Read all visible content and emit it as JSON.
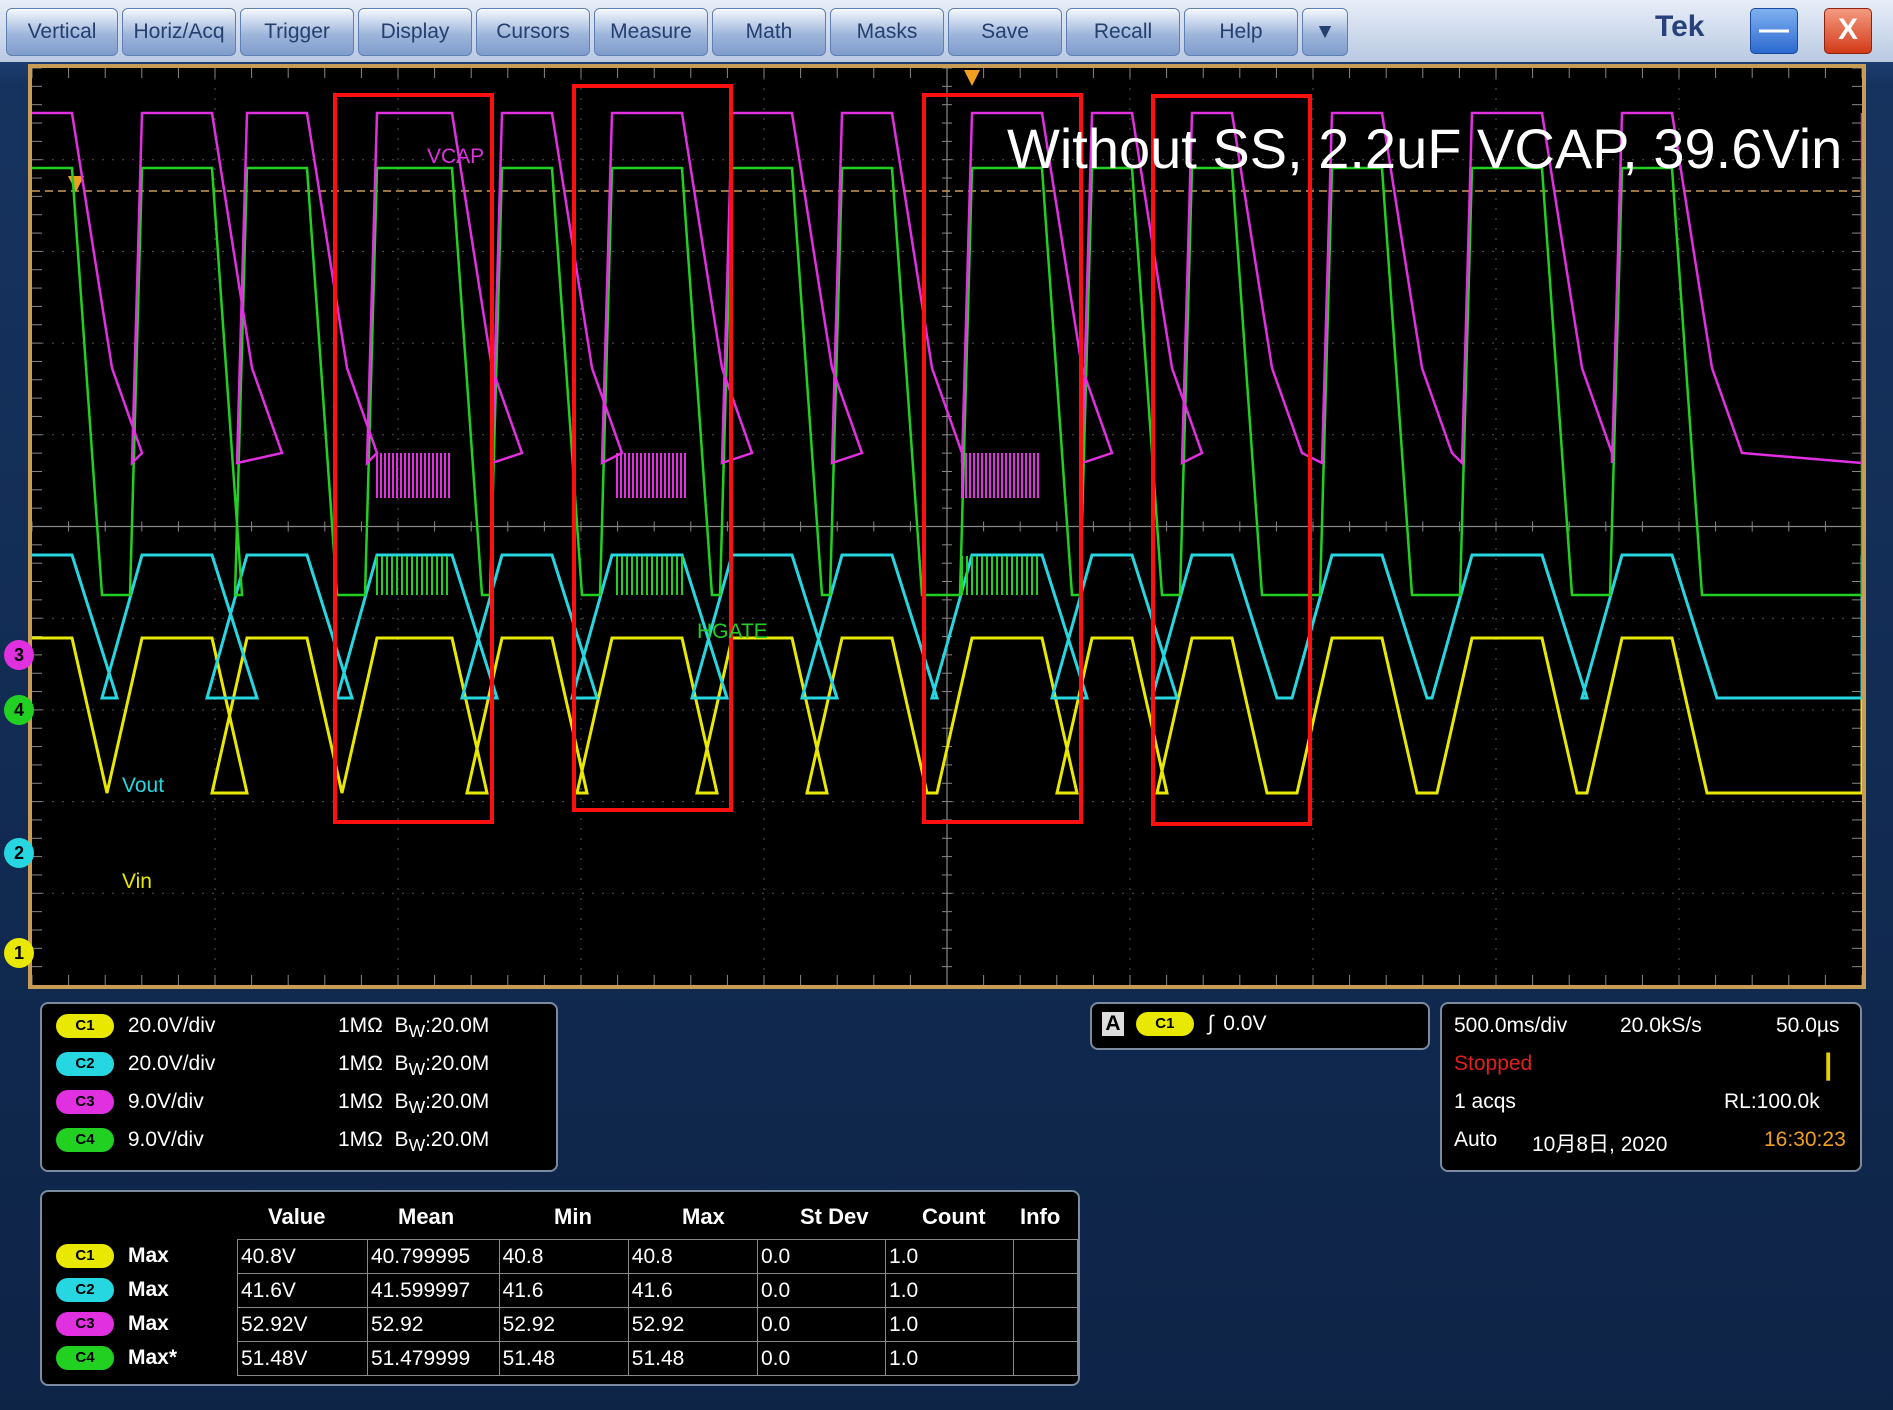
{
  "menu": {
    "items": [
      "Vertical",
      "Horiz/Acq",
      "Trigger",
      "Display",
      "Cursors",
      "Measure",
      "Math",
      "Masks",
      "Save",
      "Recall",
      "Help"
    ],
    "dropdown_glyph": "▼",
    "logo": "Tek",
    "minimize_glyph": "—",
    "close_glyph": "X"
  },
  "screen": {
    "title": "Without SS, 2.2uF VCAP, 39.6Vin",
    "labels": {
      "vcap": "VCAP",
      "hgate": "HGATE",
      "vout": "Vout",
      "vin": "Vin"
    },
    "markers": [
      "3",
      "4",
      "2",
      "1"
    ]
  },
  "channels": [
    {
      "id": "C1",
      "scale": "20.0V/div",
      "impedance": "1MΩ",
      "bw_prefix": "B",
      "bw_sub": "W",
      "bw_value": ":20.0M",
      "color": "#e8e800"
    },
    {
      "id": "C2",
      "scale": "20.0V/div",
      "impedance": "1MΩ",
      "bw_prefix": "B",
      "bw_sub": "W",
      "bw_value": ":20.0M",
      "color": "#26d6e0"
    },
    {
      "id": "C3",
      "scale": "9.0V/div",
      "impedance": "1MΩ",
      "bw_prefix": "B",
      "bw_sub": "W",
      "bw_value": ":20.0M",
      "color": "#e030e0"
    },
    {
      "id": "C4",
      "scale": "9.0V/div",
      "impedance": "1MΩ",
      "bw_prefix": "B",
      "bw_sub": "W",
      "bw_value": ":20.0M",
      "color": "#22d022"
    }
  ],
  "trigger": {
    "mode_label": "A",
    "source": "C1",
    "slope_glyph": "∫",
    "level": "0.0V"
  },
  "horizontal": {
    "time_div": "500.0ms/div",
    "sample_rate": "20.0kS/s",
    "resolution": "50.0µs",
    "status": "Stopped",
    "acqs": "1 acqs",
    "record_length": "RL:100.0k",
    "mode": "Auto",
    "date": "10月8日, 2020",
    "time": "16:30:23"
  },
  "measurements": {
    "headers": [
      "Value",
      "Mean",
      "Min",
      "Max",
      "St Dev",
      "Count",
      "Info"
    ],
    "rows": [
      {
        "ch": "C1",
        "type": "Max",
        "value": "40.8V",
        "mean": "40.799995",
        "min": "40.8",
        "max": "40.8",
        "stdev": "0.0",
        "count": "1.0",
        "info": ""
      },
      {
        "ch": "C2",
        "type": "Max",
        "value": "41.6V",
        "mean": "41.599997",
        "min": "41.6",
        "max": "41.6",
        "stdev": "0.0",
        "count": "1.0",
        "info": ""
      },
      {
        "ch": "C3",
        "type": "Max",
        "value": "52.92V",
        "mean": "52.92",
        "min": "52.92",
        "max": "52.92",
        "stdev": "0.0",
        "count": "1.0",
        "info": ""
      },
      {
        "ch": "C4",
        "type": "Max*",
        "value": "51.48V",
        "mean": "51.479999",
        "min": "51.48",
        "max": "51.48",
        "stdev": "0.0",
        "count": "1.0",
        "info": ""
      }
    ]
  }
}
